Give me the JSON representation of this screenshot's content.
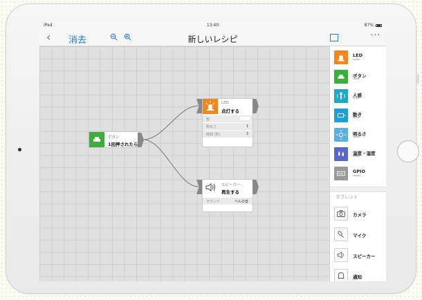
{
  "status_bar": {
    "device": "iPad",
    "time": "13:40",
    "battery": "87%"
  },
  "nav": {
    "back_icon": "chevron-left-icon",
    "erase_label": "消去",
    "title": "新しいレシピ",
    "more_icon": "more-icon"
  },
  "sidebar": {
    "items": [
      {
        "label": "LED",
        "color": "#f2871f",
        "icon": "led-icon"
      },
      {
        "label": "ボタン",
        "color": "#3cae3c",
        "icon": "button-icon"
      },
      {
        "label": "人感",
        "color": "#22a7c9",
        "icon": "motion-icon"
      },
      {
        "label": "動き",
        "color": "#1a9fd8",
        "icon": "movement-icon"
      },
      {
        "label": "明るさ",
        "color": "#5ab1e1",
        "icon": "brightness-icon"
      },
      {
        "label": "温度・湿度",
        "color": "#5b66c6",
        "icon": "temperature-icon"
      },
      {
        "label": "GPIO",
        "color": "#9a9a9a",
        "icon": "gpio-icon"
      }
    ],
    "section_tablet": "タブレット",
    "tablet_items": [
      {
        "label": "カメラ",
        "icon": "camera-icon"
      },
      {
        "label": "マイク",
        "icon": "microphone-icon"
      },
      {
        "label": "スピーカー",
        "icon": "speaker-icon"
      },
      {
        "label": "通知",
        "icon": "bell-icon"
      }
    ]
  },
  "nodes": {
    "button": {
      "type": "ボタン",
      "name": "1回押されたら",
      "color": "#3cae3c"
    },
    "led": {
      "type": "LED",
      "name": "点灯する",
      "color": "#f2871f",
      "props": [
        {
          "key": "色",
          "value": ""
        },
        {
          "key": "明るさ",
          "value": "1"
        },
        {
          "key": "時間 (秒)",
          "value": "3"
        }
      ]
    },
    "speaker": {
      "type": "スピーカー",
      "name": "再生する",
      "props": [
        {
          "key": "サウンド",
          "value": "ベルの音"
        }
      ]
    }
  }
}
